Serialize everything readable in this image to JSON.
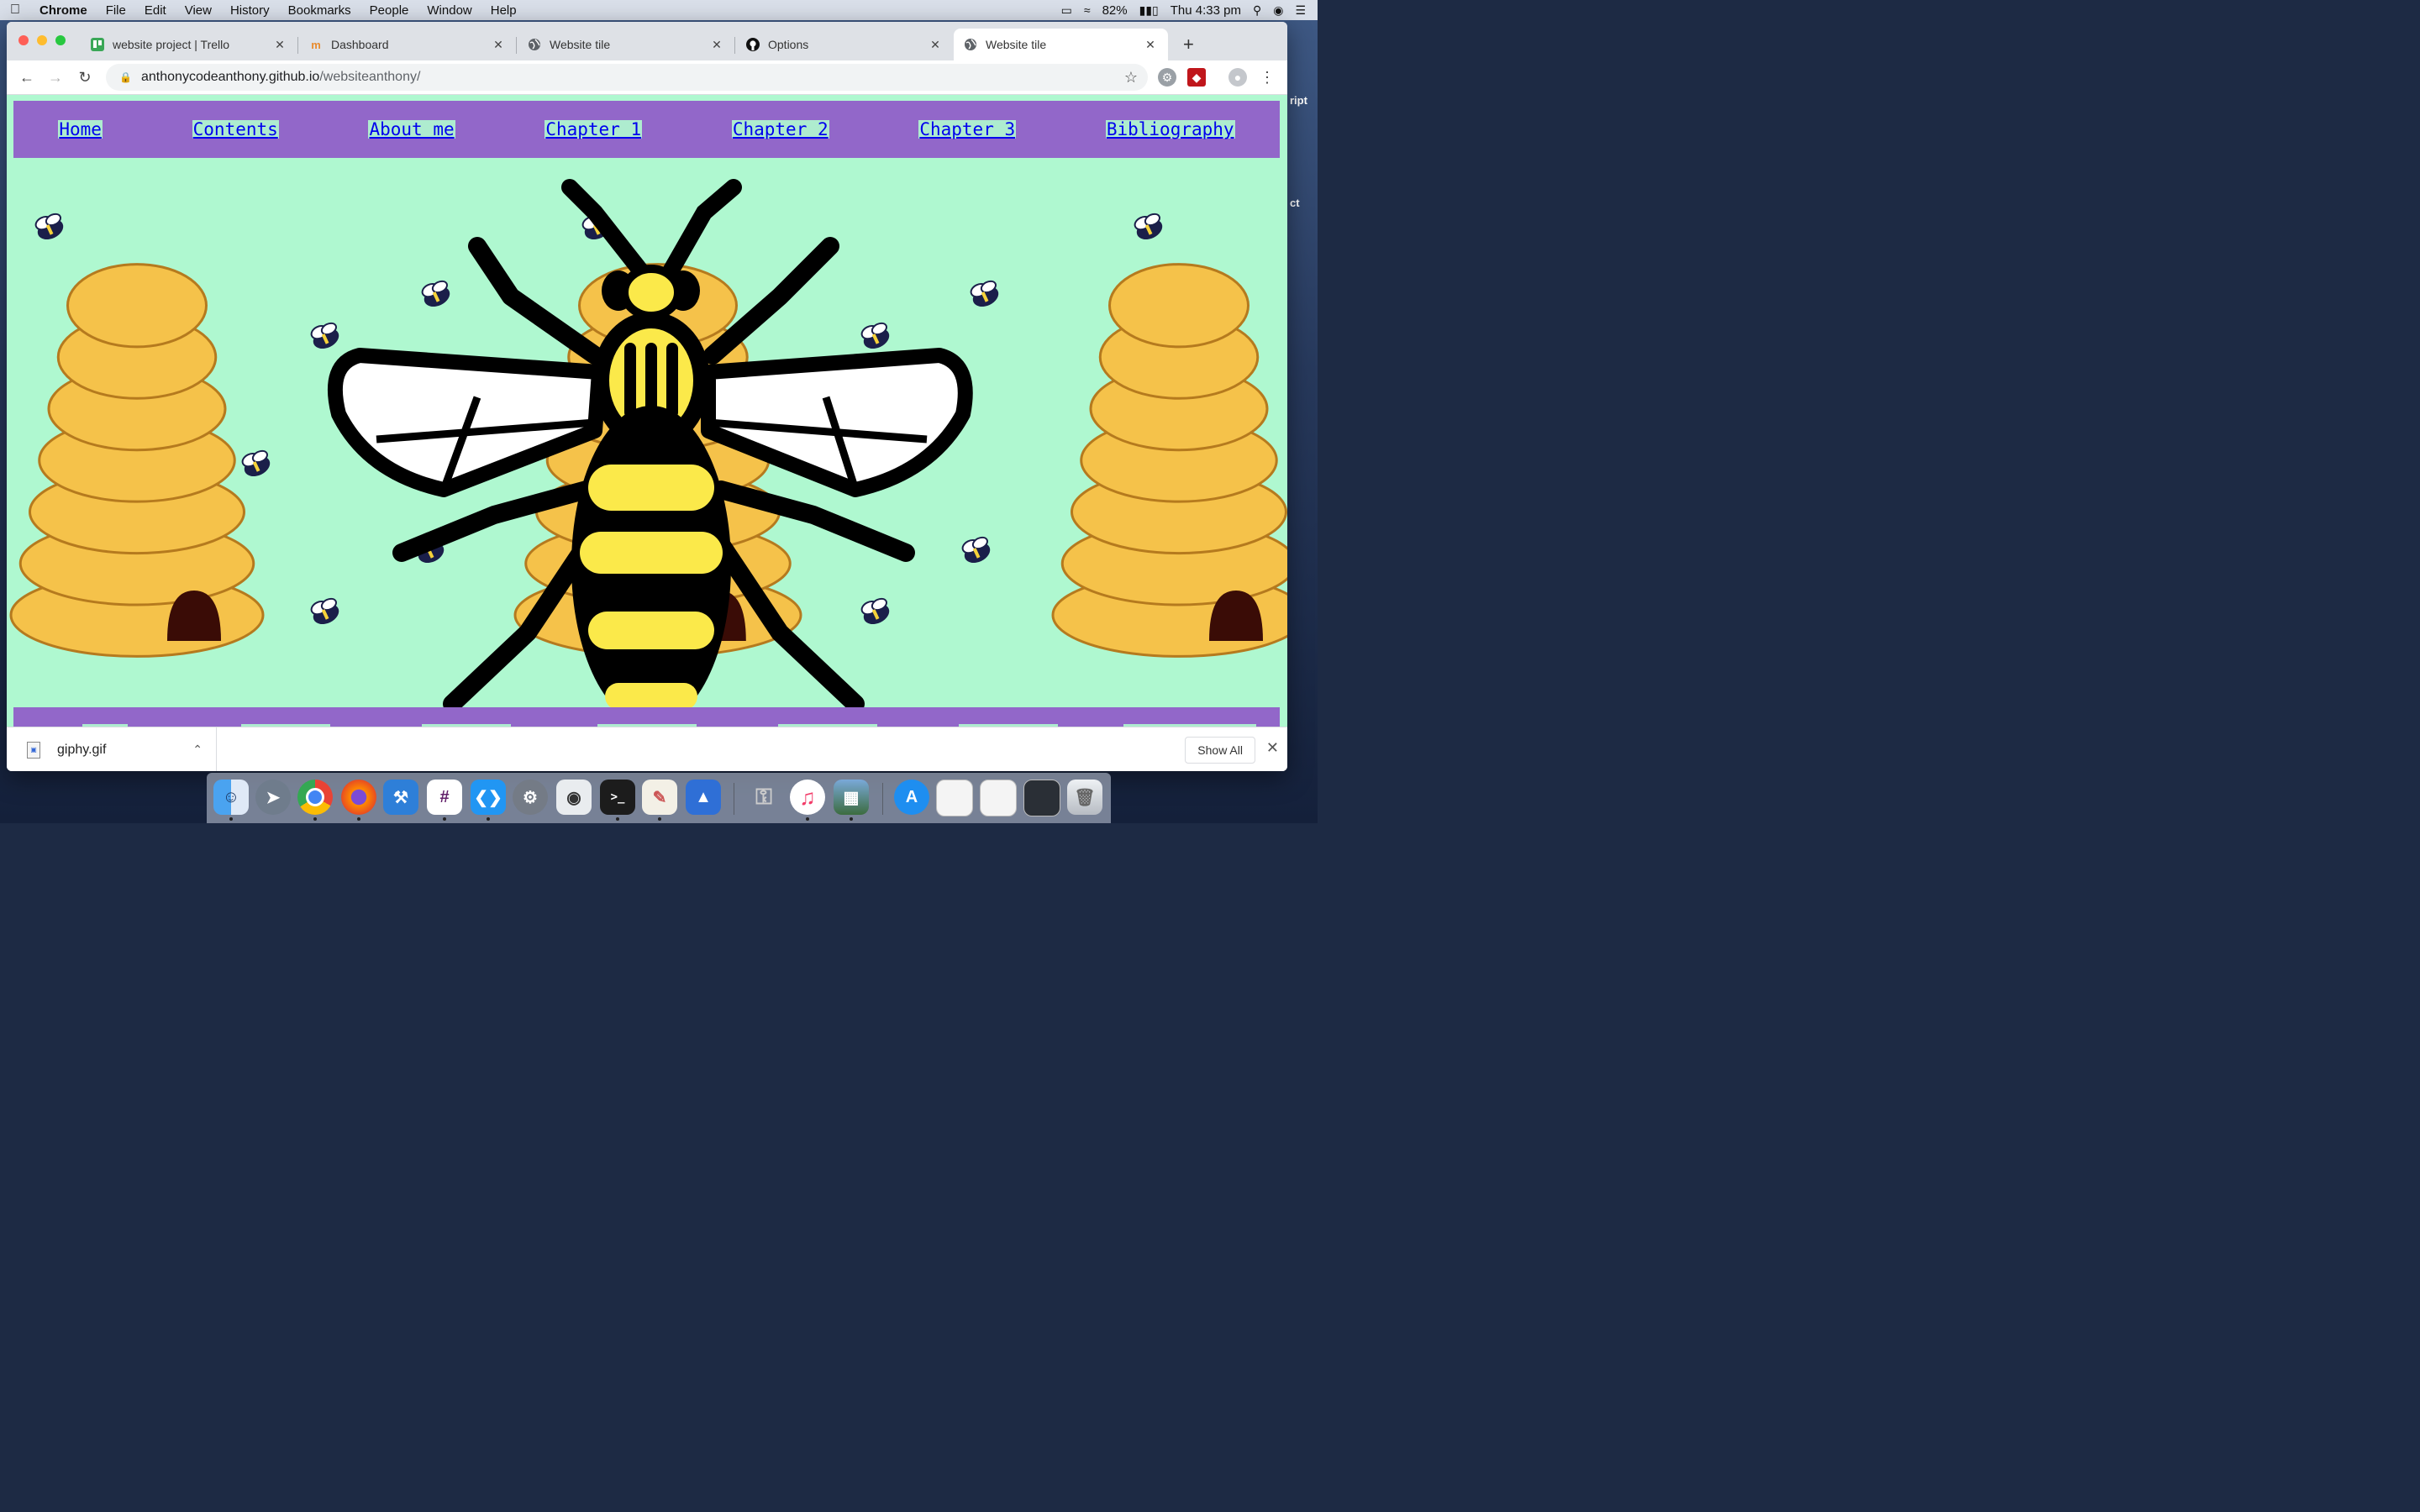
{
  "menubar": {
    "app": "Chrome",
    "items": [
      "File",
      "Edit",
      "View",
      "History",
      "Bookmarks",
      "People",
      "Window",
      "Help"
    ],
    "battery": "82%",
    "clock": "Thu 4:33 pm"
  },
  "desktop": {
    "edge_text_1": "ript",
    "edge_text_2": "ct"
  },
  "tabs": [
    {
      "title": "website project | Trello",
      "icon": "trello-icon"
    },
    {
      "title": "Dashboard",
      "icon": "dashboard-icon"
    },
    {
      "title": "Website tile",
      "icon": "globe-icon"
    },
    {
      "title": "Options",
      "icon": "github-icon"
    },
    {
      "title": "Website tile",
      "icon": "globe-icon",
      "active": true
    }
  ],
  "address": {
    "host": "anthonycodeanthony.github.io",
    "path": "/websiteanthony/"
  },
  "site": {
    "nav": [
      "Home",
      "Contents",
      "About me",
      "Chapter 1",
      "Chapter 2",
      "Chapter 3",
      "Bibliography"
    ],
    "background_color": "#aff8d0",
    "nav_color": "#9267c9",
    "link_color": "#0000ee"
  },
  "downloads": {
    "file": "giphy.gif",
    "show_all": "Show All"
  },
  "dock": {
    "apps": [
      "Finder",
      "Launchpad",
      "Chrome",
      "Firefox",
      "Xcode",
      "Slack",
      "VS Code",
      "System Preferences",
      "Screenshot",
      "Terminal",
      "TextEdit",
      "Keynote",
      "Keychain Access",
      "iTunes",
      "Preview",
      "App Store",
      "Window 1",
      "Window 2",
      "Window 3",
      "Trash"
    ]
  }
}
